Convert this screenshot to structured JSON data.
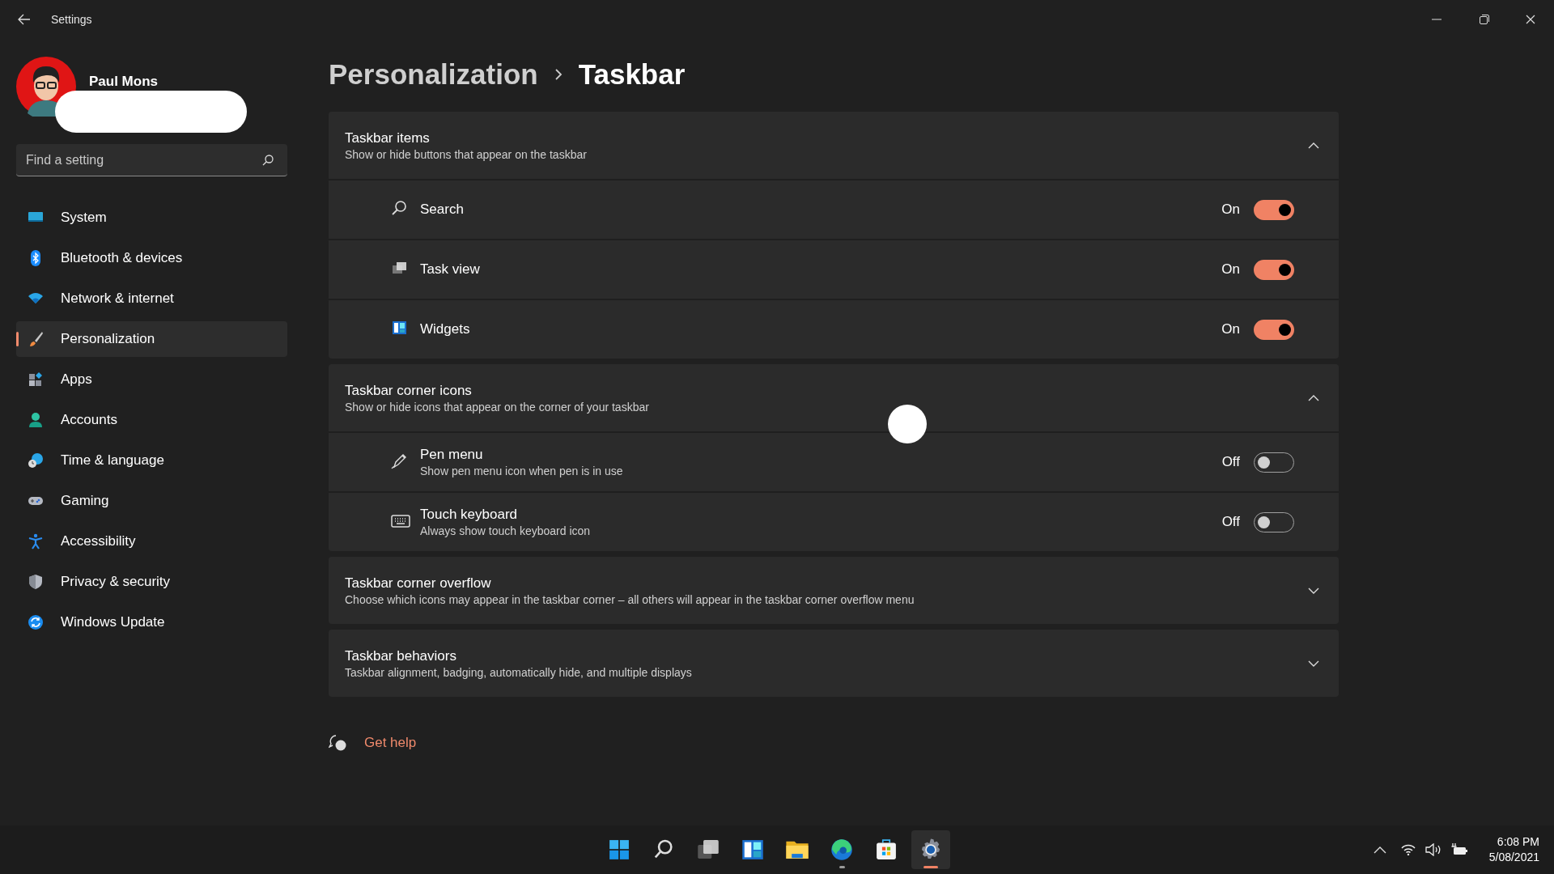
{
  "window": {
    "title": "Settings"
  },
  "user": {
    "name": "Paul Mons"
  },
  "search": {
    "placeholder": "Find a setting"
  },
  "nav": [
    {
      "kind": "system",
      "label": "System",
      "selected": false
    },
    {
      "kind": "bluetooth",
      "label": "Bluetooth & devices",
      "selected": false
    },
    {
      "kind": "network",
      "label": "Network & internet",
      "selected": false
    },
    {
      "kind": "brush",
      "label": "Personalization",
      "selected": true
    },
    {
      "kind": "apps",
      "label": "Apps",
      "selected": false
    },
    {
      "kind": "accounts",
      "label": "Accounts",
      "selected": false
    },
    {
      "kind": "time",
      "label": "Time & language",
      "selected": false
    },
    {
      "kind": "gaming",
      "label": "Gaming",
      "selected": false
    },
    {
      "kind": "accessibility",
      "label": "Accessibility",
      "selected": false
    },
    {
      "kind": "privacy",
      "label": "Privacy & security",
      "selected": false
    },
    {
      "kind": "update",
      "label": "Windows Update",
      "selected": false
    }
  ],
  "breadcrumb": [
    "Personalization",
    "Taskbar"
  ],
  "sections": [
    {
      "title": "Taskbar items",
      "subtitle": "Show or hide buttons that appear on the taskbar",
      "expanded": true,
      "items": [
        {
          "kind": "search",
          "label": "Search",
          "state_label": "On",
          "on": true
        },
        {
          "kind": "taskview",
          "label": "Task view",
          "state_label": "On",
          "on": true
        },
        {
          "kind": "widgets",
          "label": "Widgets",
          "state_label": "On",
          "on": true
        }
      ]
    },
    {
      "title": "Taskbar corner icons",
      "subtitle": "Show or hide icons that appear on the corner of your taskbar",
      "expanded": true,
      "items": [
        {
          "kind": "pen",
          "label": "Pen menu",
          "description": "Show pen menu icon when pen is in use",
          "state_label": "Off",
          "on": false
        },
        {
          "kind": "keyboard",
          "label": "Touch keyboard",
          "description": "Always show touch keyboard icon",
          "state_label": "Off",
          "on": false
        }
      ]
    },
    {
      "title": "Taskbar corner overflow",
      "subtitle": "Choose which icons may appear in the taskbar corner – all others will appear in the taskbar corner overflow menu",
      "expanded": false
    },
    {
      "title": "Taskbar behaviors",
      "subtitle": "Taskbar alignment, badging, automatically hide, and multiple displays",
      "expanded": false
    }
  ],
  "help": {
    "label": "Get help"
  },
  "taskbar": {
    "apps": [
      {
        "kind": "start",
        "active": false,
        "running": false
      },
      {
        "kind": "search",
        "active": false,
        "running": false
      },
      {
        "kind": "taskview",
        "active": false,
        "running": false
      },
      {
        "kind": "widgets",
        "active": false,
        "running": false
      },
      {
        "kind": "explorer",
        "active": false,
        "running": false
      },
      {
        "kind": "edge",
        "active": false,
        "running": true
      },
      {
        "kind": "store",
        "active": false,
        "running": false
      },
      {
        "kind": "settings",
        "active": true,
        "running": true
      }
    ],
    "time": "6:08 PM",
    "date": "5/08/2021"
  }
}
